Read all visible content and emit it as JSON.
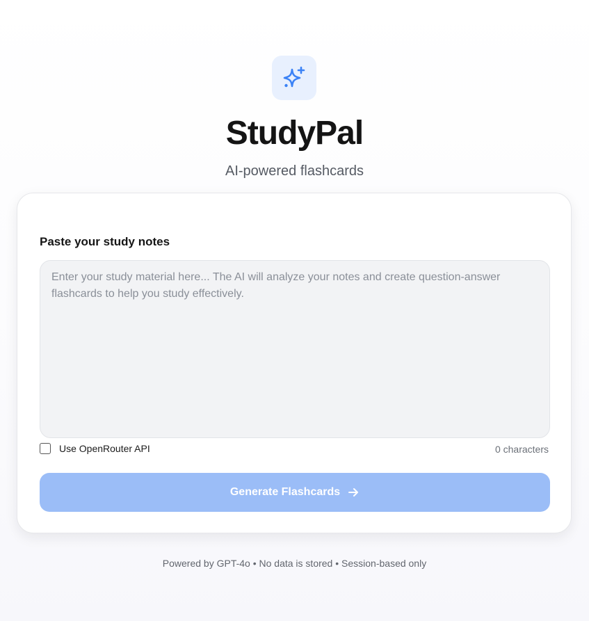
{
  "header": {
    "logo_icon": "sparkles-icon",
    "title": "StudyPal",
    "subtitle": "AI-powered flashcards"
  },
  "form": {
    "notes_label": "Paste your study notes",
    "notes_value": "",
    "notes_placeholder": "Enter your study material here... The AI will analyze your notes and create question-answer flashcards to help you study effectively.",
    "api_checkbox_label": "Use OpenRouter API",
    "api_checkbox_checked": false,
    "char_count": "0 characters",
    "generate_label": "Generate Flashcards",
    "generate_icon": "arrow-right-icon"
  },
  "footer": {
    "text": "Powered by GPT-4o • No data is stored • Session-based only"
  },
  "colors": {
    "accent": "#3b82f6",
    "logo_bg": "#e8f0fe",
    "button_disabled": "#9bbdf7"
  }
}
